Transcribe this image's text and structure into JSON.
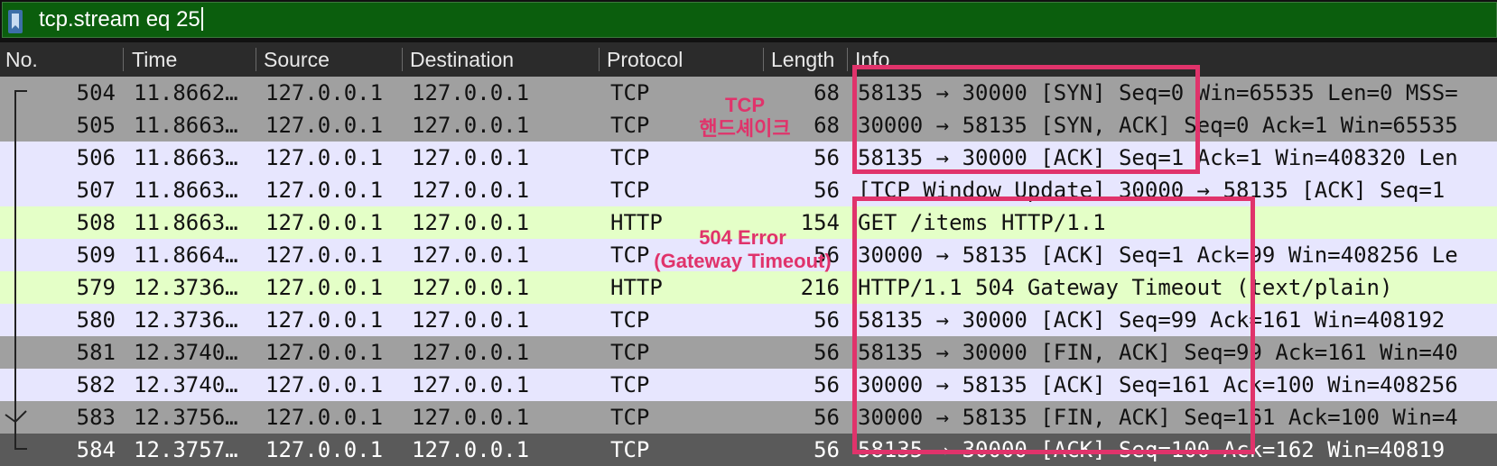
{
  "filter": {
    "value": "tcp.stream eq 25",
    "background": "#0b5e0d"
  },
  "columns": [
    "No.",
    "Time",
    "Source",
    "Destination",
    "Protocol",
    "Length",
    "Info"
  ],
  "rows": [
    {
      "no": "504",
      "time": "11.8662…",
      "source": "127.0.0.1",
      "destination": "127.0.0.1",
      "protocol": "TCP",
      "length": "68",
      "info": "58135 → 30000 [SYN] Seq=0 Win=65535 Len=0 MSS=",
      "bg": "#a0a0a0"
    },
    {
      "no": "505",
      "time": "11.8663…",
      "source": "127.0.0.1",
      "destination": "127.0.0.1",
      "protocol": "TCP",
      "length": "68",
      "info": "30000 → 58135 [SYN, ACK] Seq=0 Ack=1 Win=65535",
      "bg": "#a0a0a0"
    },
    {
      "no": "506",
      "time": "11.8663…",
      "source": "127.0.0.1",
      "destination": "127.0.0.1",
      "protocol": "TCP",
      "length": "56",
      "info": "58135 → 30000 [ACK] Seq=1 Ack=1 Win=408320 Len",
      "bg": "#e7e6fe"
    },
    {
      "no": "507",
      "time": "11.8663…",
      "source": "127.0.0.1",
      "destination": "127.0.0.1",
      "protocol": "TCP",
      "length": "56",
      "info": "[TCP Window Update] 30000 → 58135 [ACK] Seq=1",
      "bg": "#e7e6fe"
    },
    {
      "no": "508",
      "time": "11.8663…",
      "source": "127.0.0.1",
      "destination": "127.0.0.1",
      "protocol": "HTTP",
      "length": "154",
      "info": "GET /items HTTP/1.1",
      "bg": "#e4ffc7"
    },
    {
      "no": "509",
      "time": "11.8664…",
      "source": "127.0.0.1",
      "destination": "127.0.0.1",
      "protocol": "TCP",
      "length": "56",
      "info": "30000 → 58135 [ACK] Seq=1 Ack=99 Win=408256 Le",
      "bg": "#e7e6fe"
    },
    {
      "no": "579",
      "time": "12.3736…",
      "source": "127.0.0.1",
      "destination": "127.0.0.1",
      "protocol": "HTTP",
      "length": "216",
      "info": "HTTP/1.1 504 Gateway Timeout  (text/plain)",
      "bg": "#e4ffc7"
    },
    {
      "no": "580",
      "time": "12.3736…",
      "source": "127.0.0.1",
      "destination": "127.0.0.1",
      "protocol": "TCP",
      "length": "56",
      "info": "58135 → 30000 [ACK] Seq=99 Ack=161 Win=408192",
      "bg": "#e7e6fe"
    },
    {
      "no": "581",
      "time": "12.3740…",
      "source": "127.0.0.1",
      "destination": "127.0.0.1",
      "protocol": "TCP",
      "length": "56",
      "info": "58135 → 30000 [FIN, ACK] Seq=99 Ack=161 Win=40",
      "bg": "#a0a0a0"
    },
    {
      "no": "582",
      "time": "12.3740…",
      "source": "127.0.0.1",
      "destination": "127.0.0.1",
      "protocol": "TCP",
      "length": "56",
      "info": "30000 → 58135 [ACK] Seq=161 Ack=100 Win=408256",
      "bg": "#e7e6fe"
    },
    {
      "no": "583",
      "time": "12.3756…",
      "source": "127.0.0.1",
      "destination": "127.0.0.1",
      "protocol": "TCP",
      "length": "56",
      "info": "30000 → 58135 [FIN, ACK] Seq=161 Ack=100 Win=4",
      "bg": "#a0a0a0"
    },
    {
      "no": "584",
      "time": "12.3757…",
      "source": "127.0.0.1",
      "destination": "127.0.0.1",
      "protocol": "TCP",
      "length": "56",
      "info": "58135 → 30000 [ACK] Seq=100 Ack=162 Win=40819",
      "bg": "#5a5a5a",
      "fg": "#ffffff"
    }
  ],
  "annotations": {
    "handshake_line1": "TCP",
    "handshake_line2": "핸드셰이크",
    "error_line1": "504 Error",
    "error_line2": "(Gateway Timeout)",
    "color": "#e0336b"
  }
}
